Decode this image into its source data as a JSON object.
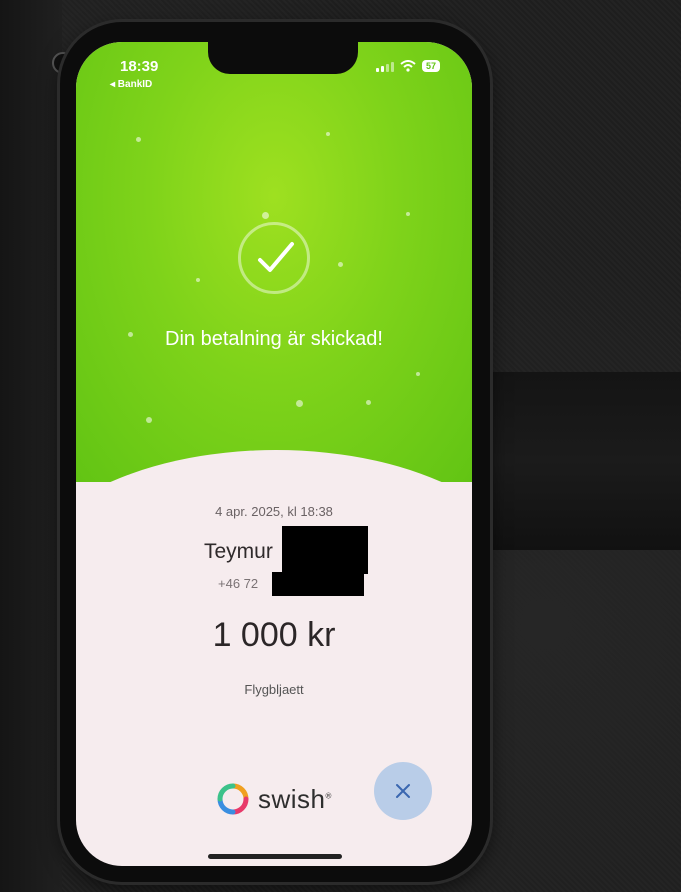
{
  "status_bar": {
    "time": "18:39",
    "back_app": "◂ BankID",
    "battery": "57"
  },
  "confirmation": {
    "message": "Din betalning är skickad!",
    "icon": "checkmark-icon"
  },
  "payment": {
    "date": "4 apr. 2025, kl 18:38",
    "recipient_name": "Teymur",
    "recipient_phone": "+46 72",
    "amount": "1 000 kr",
    "message": "Flygbljaett"
  },
  "brand": {
    "name": "swish",
    "trademark": "®"
  },
  "colors": {
    "success_green": "#7fd31a",
    "close_button": "#b9cde8"
  }
}
